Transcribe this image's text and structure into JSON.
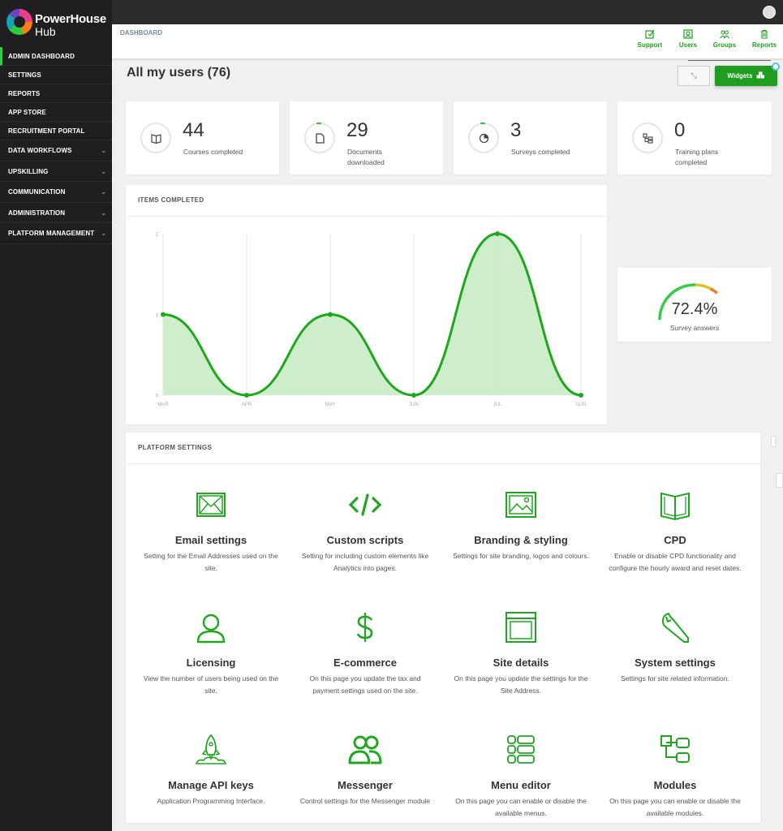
{
  "brand": {
    "line1": "PowerHouse",
    "line2": "Hub"
  },
  "sidebar": {
    "items": [
      {
        "label": "ADMIN DASHBOARD",
        "active": true,
        "expandable": false
      },
      {
        "label": "SETTINGS",
        "active": false,
        "expandable": false
      },
      {
        "label": "REPORTS",
        "active": false,
        "expandable": false
      },
      {
        "label": "APP STORE",
        "active": false,
        "expandable": false
      },
      {
        "label": "RECRUITMENT PORTAL",
        "active": false,
        "expandable": false
      },
      {
        "label": "DATA WORKFLOWS",
        "active": false,
        "expandable": true
      },
      {
        "label": "UPSKILLING",
        "active": false,
        "expandable": true
      },
      {
        "label": "COMMUNICATION",
        "active": false,
        "expandable": true
      },
      {
        "label": "ADMINISTRATION",
        "active": false,
        "expandable": true
      },
      {
        "label": "PLATFORM MANAGEMENT",
        "active": false,
        "expandable": true
      }
    ],
    "chevron": "⌄"
  },
  "header": {
    "breadcrumb": "DASHBOARD",
    "actions": [
      {
        "label": "Support",
        "icon": "edit-icon"
      },
      {
        "label": "Users",
        "icon": "user-icon"
      },
      {
        "label": "Groups",
        "icon": "groups-icon"
      },
      {
        "label": "Reports",
        "icon": "trash-icon"
      }
    ]
  },
  "page": {
    "title": "All my users (76)",
    "collapse_icon": "⤡",
    "widgets_label": "Widgets"
  },
  "stats": [
    {
      "value": "44",
      "label": "Courses completed",
      "icon": "book-icon"
    },
    {
      "value": "29",
      "label": "Documents downloaded",
      "icon": "document-icon"
    },
    {
      "value": "3",
      "label": "Surveys completed",
      "icon": "pie-icon"
    },
    {
      "value": "0",
      "label": "Training plans completed",
      "icon": "sitemap-icon"
    }
  ],
  "items_chart": {
    "title": "ITEMS COMPLETED"
  },
  "chart_data": {
    "type": "area",
    "title": "ITEMS COMPLETED",
    "categories": [
      "MAR",
      "APR",
      "MAY",
      "JUN",
      "JUL",
      "AUG"
    ],
    "values": [
      1,
      0,
      1,
      0,
      2,
      0
    ],
    "yticks": [
      "0",
      "1",
      "2"
    ],
    "ylim": [
      0,
      2
    ],
    "grid": "vertical",
    "color": "#1ea81e",
    "fill": "#c9ebc4"
  },
  "gauge": {
    "value": "72.4%",
    "fraction": 0.724,
    "label": "Survey answers"
  },
  "platform": {
    "title": "PLATFORM SETTINGS",
    "tiles": [
      {
        "title": "Email settings",
        "desc": "Setting for the Email Addresses used on the site.",
        "icon": "envelope-icon"
      },
      {
        "title": "Custom scripts",
        "desc": "Setting for including custom elements like Analytics into pages.",
        "icon": "code-icon"
      },
      {
        "title": "Branding & styling",
        "desc": "Settings for site branding, logos and colours.",
        "icon": "image-icon"
      },
      {
        "title": "CPD",
        "desc": "Enable or disable CPD functionality and configure the hourly award and reset dates.",
        "icon": "open-book-icon"
      },
      {
        "title": "Licensing",
        "desc": "View the number of users being used on the site.",
        "icon": "user-outline-icon"
      },
      {
        "title": "E-commerce",
        "desc": "On this page you update the tax and payment settings used on the site.",
        "icon": "dollar-icon"
      },
      {
        "title": "Site details",
        "desc": "On this page you update the settings for the Site Address.",
        "icon": "window-icon"
      },
      {
        "title": "System settings",
        "desc": "Settings for site related information.",
        "icon": "wrench-icon"
      },
      {
        "title": "Manage API keys",
        "desc": "Application Programming Interface.",
        "icon": "rocket-icon"
      },
      {
        "title": "Messenger",
        "desc": "Control settings for the Messenger module",
        "icon": "users-icon"
      },
      {
        "title": "Menu editor",
        "desc": "On this page you can enable or disable the available menus.",
        "icon": "menu-icon"
      },
      {
        "title": "Modules",
        "desc": "On this page you can enable or disable the available modules.",
        "icon": "modules-icon"
      }
    ]
  },
  "colors": {
    "accent": "#1ea81e",
    "sidebar": "#1f1f22",
    "topbar": "#2b2b2e"
  }
}
